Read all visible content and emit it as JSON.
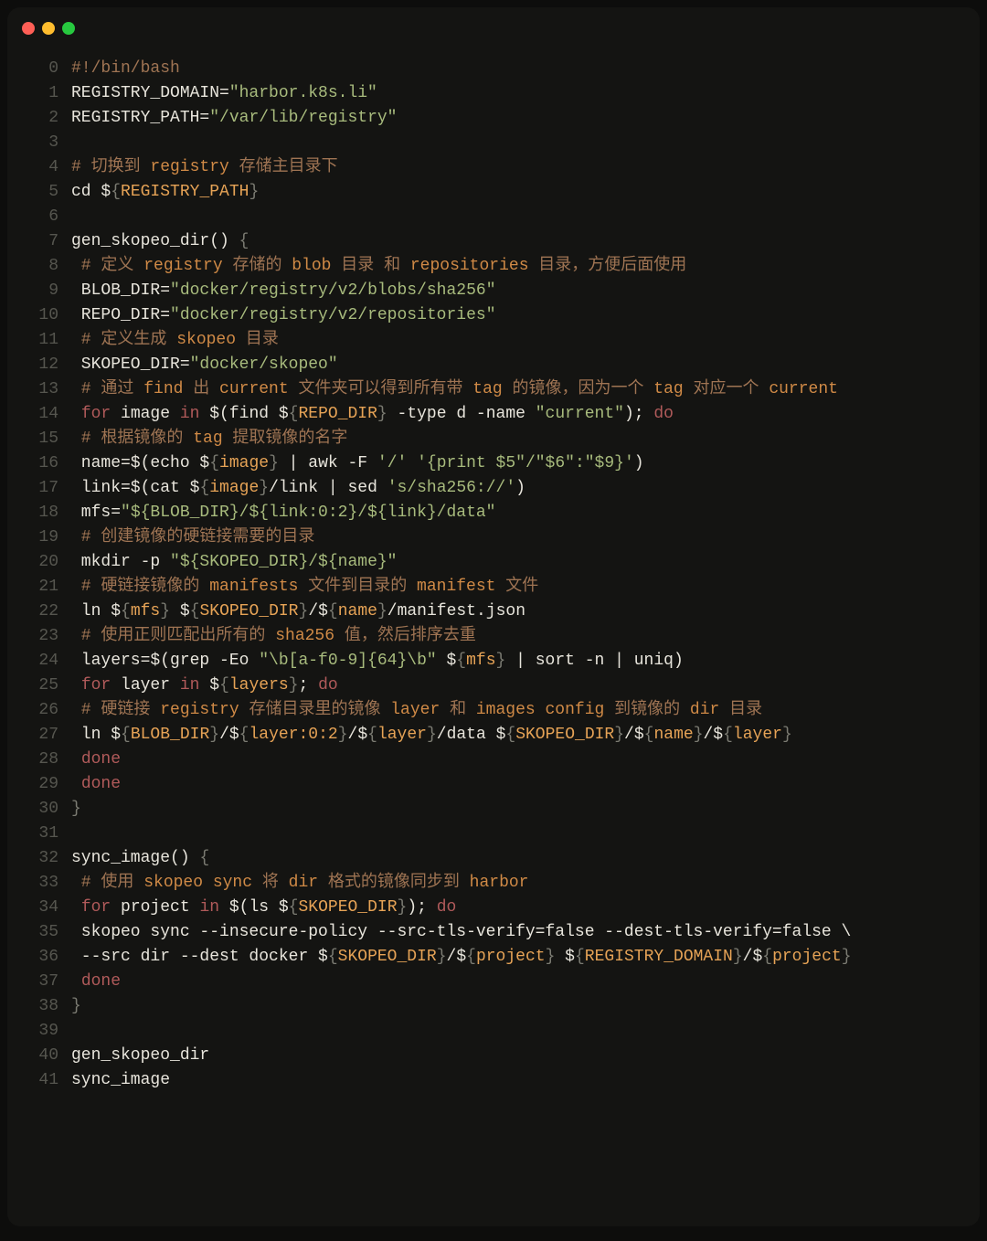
{
  "window": {
    "type": "macos",
    "buttons": [
      "close",
      "minimize",
      "zoom"
    ]
  },
  "gutter": [
    "0",
    "1",
    "2",
    "3",
    "4",
    "5",
    "6",
    "7",
    "8",
    "9",
    "10",
    "11",
    "12",
    "13",
    "14",
    "15",
    "16",
    "17",
    "18",
    "19",
    "20",
    "21",
    "22",
    "23",
    "24",
    "25",
    "26",
    "27",
    "28",
    "29",
    "30",
    "31",
    "32",
    "33",
    "34",
    "35",
    "36",
    "37",
    "38",
    "39",
    "40",
    "41"
  ],
  "lines": [
    [
      [
        "com",
        "#!/bin/bash"
      ]
    ],
    [
      [
        "def",
        "REGISTRY_DOMAIN="
      ],
      [
        "str",
        "\"harbor.k8s.li\""
      ]
    ],
    [
      [
        "def",
        "REGISTRY_PATH="
      ],
      [
        "str",
        "\"/var/lib/registry\""
      ]
    ],
    [
      [
        "def",
        ""
      ]
    ],
    [
      [
        "com",
        "# 切换到 "
      ],
      [
        "comk",
        "registry"
      ],
      [
        "com",
        " 存储主目录下"
      ]
    ],
    [
      [
        "def",
        "cd $"
      ],
      [
        "brc",
        "{"
      ],
      [
        "var",
        "REGISTRY_PATH"
      ],
      [
        "brc",
        "}"
      ]
    ],
    [
      [
        "def",
        ""
      ]
    ],
    [
      [
        "def",
        "gen_skopeo_dir() "
      ],
      [
        "brc",
        "{"
      ]
    ],
    [
      [
        "com",
        " # 定义 "
      ],
      [
        "comk",
        "registry"
      ],
      [
        "com",
        " 存储的 "
      ],
      [
        "comk",
        "blob"
      ],
      [
        "com",
        " 目录 和 "
      ],
      [
        "comk",
        "repositories"
      ],
      [
        "com",
        " 目录，方便后面使用"
      ]
    ],
    [
      [
        "def",
        " BLOB_DIR="
      ],
      [
        "str",
        "\"docker/registry/v2/blobs/sha256\""
      ]
    ],
    [
      [
        "def",
        " REPO_DIR="
      ],
      [
        "str",
        "\"docker/registry/v2/repositories\""
      ]
    ],
    [
      [
        "com",
        " # 定义生成 "
      ],
      [
        "comk",
        "skopeo"
      ],
      [
        "com",
        " 目录"
      ]
    ],
    [
      [
        "def",
        " SKOPEO_DIR="
      ],
      [
        "str",
        "\"docker/skopeo\""
      ]
    ],
    [
      [
        "com",
        " # 通过 "
      ],
      [
        "comk",
        "find"
      ],
      [
        "com",
        " 出 "
      ],
      [
        "comk",
        "current"
      ],
      [
        "com",
        " 文件夹可以得到所有带 "
      ],
      [
        "comk",
        "tag"
      ],
      [
        "com",
        " 的镜像，因为一个 "
      ],
      [
        "comk",
        "tag"
      ],
      [
        "com",
        " 对应一个 "
      ],
      [
        "comk",
        "current"
      ]
    ],
    [
      [
        "def",
        " "
      ],
      [
        "kw",
        "for"
      ],
      [
        "def",
        " image "
      ],
      [
        "kw",
        "in"
      ],
      [
        "def",
        " $(find $"
      ],
      [
        "brc",
        "{"
      ],
      [
        "var",
        "REPO_DIR"
      ],
      [
        "brc",
        "}"
      ],
      [
        "def",
        " -type d -name "
      ],
      [
        "str",
        "\"current\""
      ],
      [
        "def",
        "); "
      ],
      [
        "kw",
        "do"
      ]
    ],
    [
      [
        "com",
        " # 根据镜像的 "
      ],
      [
        "comk",
        "tag"
      ],
      [
        "com",
        " 提取镜像的名字"
      ]
    ],
    [
      [
        "def",
        " name=$(echo $"
      ],
      [
        "brc",
        "{"
      ],
      [
        "var",
        "image"
      ],
      [
        "brc",
        "}"
      ],
      [
        "def",
        " | awk -F "
      ],
      [
        "str",
        "'/'"
      ],
      [
        "def",
        " "
      ],
      [
        "str",
        "'{print $5\"/\"$6\":\"$9}'"
      ],
      [
        "def",
        ")"
      ]
    ],
    [
      [
        "def",
        " link=$(cat $"
      ],
      [
        "brc",
        "{"
      ],
      [
        "var",
        "image"
      ],
      [
        "brc",
        "}"
      ],
      [
        "def",
        "/link | sed "
      ],
      [
        "str",
        "'s/sha256://'"
      ],
      [
        "def",
        ")"
      ]
    ],
    [
      [
        "def",
        " mfs="
      ],
      [
        "str",
        "\"${BLOB_DIR}/${link:0:2}/${link}/data\""
      ]
    ],
    [
      [
        "com",
        " # 创建镜像的硬链接需要的目录"
      ]
    ],
    [
      [
        "def",
        " mkdir -p "
      ],
      [
        "str",
        "\"${SKOPEO_DIR}/${name}\""
      ]
    ],
    [
      [
        "com",
        " # 硬链接镜像的 "
      ],
      [
        "comk",
        "manifests"
      ],
      [
        "com",
        " 文件到目录的 "
      ],
      [
        "comk",
        "manifest"
      ],
      [
        "com",
        " 文件"
      ]
    ],
    [
      [
        "def",
        " ln $"
      ],
      [
        "brc",
        "{"
      ],
      [
        "var",
        "mfs"
      ],
      [
        "brc",
        "}"
      ],
      [
        "def",
        " $"
      ],
      [
        "brc",
        "{"
      ],
      [
        "var",
        "SKOPEO_DIR"
      ],
      [
        "brc",
        "}"
      ],
      [
        "def",
        "/$"
      ],
      [
        "brc",
        "{"
      ],
      [
        "var",
        "name"
      ],
      [
        "brc",
        "}"
      ],
      [
        "def",
        "/manifest.json"
      ]
    ],
    [
      [
        "com",
        " # 使用正则匹配出所有的 "
      ],
      [
        "comk",
        "sha256"
      ],
      [
        "com",
        " 值，然后排序去重"
      ]
    ],
    [
      [
        "def",
        " layers=$(grep -Eo "
      ],
      [
        "str",
        "\"\\b[a-f0-9]{64}\\b\""
      ],
      [
        "def",
        " $"
      ],
      [
        "brc",
        "{"
      ],
      [
        "var",
        "mfs"
      ],
      [
        "brc",
        "}"
      ],
      [
        "def",
        " | sort -n | uniq)"
      ]
    ],
    [
      [
        "def",
        " "
      ],
      [
        "kw",
        "for"
      ],
      [
        "def",
        " layer "
      ],
      [
        "kw",
        "in"
      ],
      [
        "def",
        " $"
      ],
      [
        "brc",
        "{"
      ],
      [
        "var",
        "layers"
      ],
      [
        "brc",
        "}"
      ],
      [
        "def",
        "; "
      ],
      [
        "kw",
        "do"
      ]
    ],
    [
      [
        "com",
        " # 硬链接 "
      ],
      [
        "comk",
        "registry"
      ],
      [
        "com",
        " 存储目录里的镜像 "
      ],
      [
        "comk",
        "layer"
      ],
      [
        "com",
        " 和 "
      ],
      [
        "comk",
        "images config"
      ],
      [
        "com",
        " 到镜像的 "
      ],
      [
        "comk",
        "dir"
      ],
      [
        "com",
        " 目录"
      ]
    ],
    [
      [
        "def",
        " ln $"
      ],
      [
        "brc",
        "{"
      ],
      [
        "var",
        "BLOB_DIR"
      ],
      [
        "brc",
        "}"
      ],
      [
        "def",
        "/$"
      ],
      [
        "brc",
        "{"
      ],
      [
        "var",
        "layer:0:2"
      ],
      [
        "brc",
        "}"
      ],
      [
        "def",
        "/$"
      ],
      [
        "brc",
        "{"
      ],
      [
        "var",
        "layer"
      ],
      [
        "brc",
        "}"
      ],
      [
        "def",
        "/data $"
      ],
      [
        "brc",
        "{"
      ],
      [
        "var",
        "SKOPEO_DIR"
      ],
      [
        "brc",
        "}"
      ],
      [
        "def",
        "/$"
      ],
      [
        "brc",
        "{"
      ],
      [
        "var",
        "name"
      ],
      [
        "brc",
        "}"
      ],
      [
        "def",
        "/$"
      ],
      [
        "brc",
        "{"
      ],
      [
        "var",
        "layer"
      ],
      [
        "brc",
        "}"
      ]
    ],
    [
      [
        "def",
        " "
      ],
      [
        "kw",
        "done"
      ]
    ],
    [
      [
        "def",
        " "
      ],
      [
        "kw",
        "done"
      ]
    ],
    [
      [
        "brc",
        "}"
      ]
    ],
    [
      [
        "def",
        ""
      ]
    ],
    [
      [
        "def",
        "sync_image() "
      ],
      [
        "brc",
        "{"
      ]
    ],
    [
      [
        "com",
        " # 使用 "
      ],
      [
        "comk",
        "skopeo sync"
      ],
      [
        "com",
        " 将 "
      ],
      [
        "comk",
        "dir"
      ],
      [
        "com",
        " 格式的镜像同步到 "
      ],
      [
        "comk",
        "harbor"
      ]
    ],
    [
      [
        "def",
        " "
      ],
      [
        "kw",
        "for"
      ],
      [
        "def",
        " project "
      ],
      [
        "kw",
        "in"
      ],
      [
        "def",
        " $(ls $"
      ],
      [
        "brc",
        "{"
      ],
      [
        "var",
        "SKOPEO_DIR"
      ],
      [
        "brc",
        "}"
      ],
      [
        "def",
        "); "
      ],
      [
        "kw",
        "do"
      ]
    ],
    [
      [
        "def",
        " skopeo sync --insecure-policy --src-tls-verify=false --dest-tls-verify=false \\"
      ]
    ],
    [
      [
        "def",
        " --src dir --dest docker $"
      ],
      [
        "brc",
        "{"
      ],
      [
        "var",
        "SKOPEO_DIR"
      ],
      [
        "brc",
        "}"
      ],
      [
        "def",
        "/$"
      ],
      [
        "brc",
        "{"
      ],
      [
        "var",
        "project"
      ],
      [
        "brc",
        "}"
      ],
      [
        "def",
        " $"
      ],
      [
        "brc",
        "{"
      ],
      [
        "var",
        "REGISTRY_DOMAIN"
      ],
      [
        "brc",
        "}"
      ],
      [
        "def",
        "/$"
      ],
      [
        "brc",
        "{"
      ],
      [
        "var",
        "project"
      ],
      [
        "brc",
        "}"
      ]
    ],
    [
      [
        "def",
        " "
      ],
      [
        "kw",
        "done"
      ]
    ],
    [
      [
        "brc",
        "}"
      ]
    ],
    [
      [
        "def",
        ""
      ]
    ],
    [
      [
        "def",
        "gen_skopeo_dir"
      ]
    ],
    [
      [
        "def",
        "sync_image"
      ]
    ]
  ]
}
